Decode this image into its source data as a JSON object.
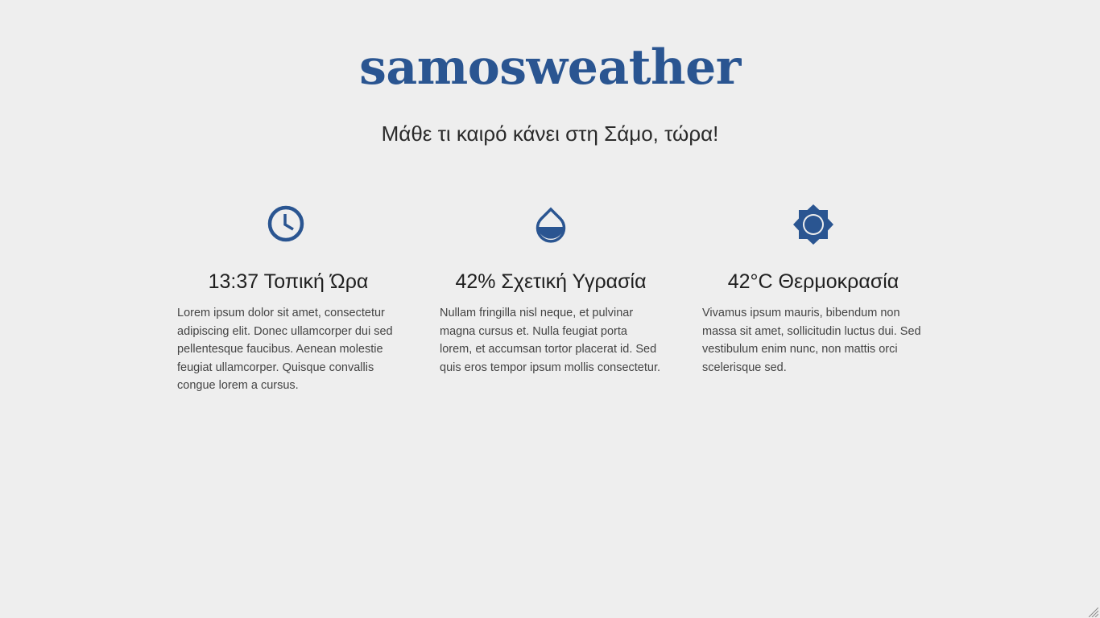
{
  "header": {
    "title": "samosweather",
    "subtitle": "Μάθε τι καιρό κάνει στη Σάμο, τώρα!"
  },
  "colors": {
    "background": "#eeeeee",
    "accent": "#2a5591",
    "text": "#222222"
  },
  "features": [
    {
      "icon": "clock-icon",
      "heading": "13:37 Τοπική Ώρα",
      "text": "Lorem ipsum dolor sit amet, consectetur adipiscing elit. Donec ullamcorper dui sed pellentesque faucibus. Aenean molestie feugiat ullamcorper. Quisque convallis congue lorem a cursus."
    },
    {
      "icon": "water-drop-icon",
      "heading": "42% Σχετική Υγρασία",
      "text": "Nullam fringilla nisl neque, et pulvinar magna cursus et. Nulla feugiat porta lorem, et accumsan tortor placerat id. Sed quis eros tempor ipsum mollis consectetur."
    },
    {
      "icon": "sun-icon",
      "heading": "42°C Θερμοκρασία",
      "text": "Vivamus ipsum mauris, bibendum non massa sit amet, sollicitudin luctus dui. Sed vestibulum enim nunc, non mattis orci scelerisque sed."
    }
  ]
}
